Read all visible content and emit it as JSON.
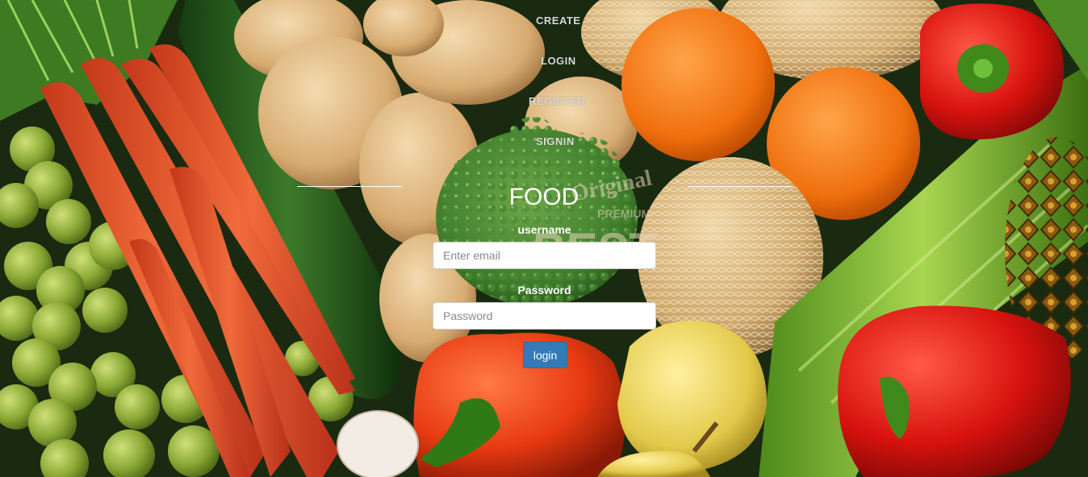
{
  "nav": {
    "create": "CREATE",
    "login": "LOGIN",
    "register": "REGISTER",
    "signin": "SIGNIN"
  },
  "form": {
    "title": "FOOD",
    "username_label": "username",
    "email_placeholder": "Enter email",
    "password_label": "Password",
    "password_placeholder": "Password",
    "submit_label": "login"
  },
  "colors": {
    "button": "#337ab7",
    "text": "#ffffff"
  }
}
